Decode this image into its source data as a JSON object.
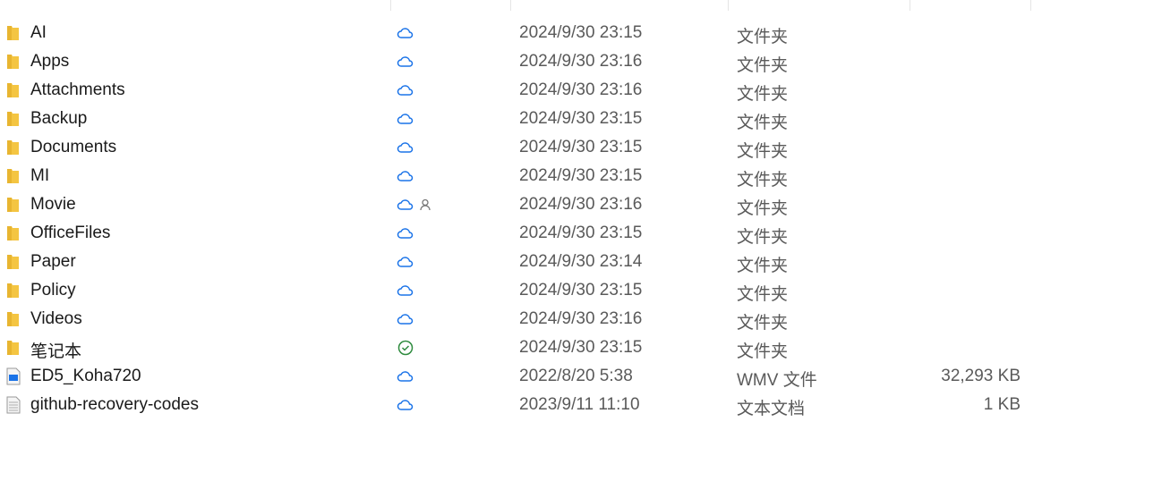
{
  "colors": {
    "cloud": "#1a73e8",
    "synced": "#2e8b3e",
    "folder": "#f4c542"
  },
  "rows": [
    {
      "name": "AI",
      "status": "cloud",
      "date": "2024/9/30 23:15",
      "type": "文件夹",
      "size": "",
      "icon": "folder"
    },
    {
      "name": "Apps",
      "status": "cloud",
      "date": "2024/9/30 23:16",
      "type": "文件夹",
      "size": "",
      "icon": "folder"
    },
    {
      "name": "Attachments",
      "status": "cloud",
      "date": "2024/9/30 23:16",
      "type": "文件夹",
      "size": "",
      "icon": "folder"
    },
    {
      "name": "Backup",
      "status": "cloud",
      "date": "2024/9/30 23:15",
      "type": "文件夹",
      "size": "",
      "icon": "folder"
    },
    {
      "name": "Documents",
      "status": "cloud",
      "date": "2024/9/30 23:15",
      "type": "文件夹",
      "size": "",
      "icon": "folder"
    },
    {
      "name": "MI",
      "status": "cloud",
      "date": "2024/9/30 23:15",
      "type": "文件夹",
      "size": "",
      "icon": "folder"
    },
    {
      "name": "Movie",
      "status": "cloud-shared",
      "date": "2024/9/30 23:16",
      "type": "文件夹",
      "size": "",
      "icon": "folder"
    },
    {
      "name": "OfficeFiles",
      "status": "cloud",
      "date": "2024/9/30 23:15",
      "type": "文件夹",
      "size": "",
      "icon": "folder"
    },
    {
      "name": "Paper",
      "status": "cloud",
      "date": "2024/9/30 23:14",
      "type": "文件夹",
      "size": "",
      "icon": "folder"
    },
    {
      "name": "Policy",
      "status": "cloud",
      "date": "2024/9/30 23:15",
      "type": "文件夹",
      "size": "",
      "icon": "folder"
    },
    {
      "name": "Videos",
      "status": "cloud",
      "date": "2024/9/30 23:16",
      "type": "文件夹",
      "size": "",
      "icon": "folder"
    },
    {
      "name": "笔记本",
      "status": "synced",
      "date": "2024/9/30 23:15",
      "type": "文件夹",
      "size": "",
      "icon": "folder"
    },
    {
      "name": "ED5_Koha720",
      "status": "cloud",
      "date": "2022/8/20 5:38",
      "type": "WMV 文件",
      "size": "32,293 KB",
      "icon": "video-file"
    },
    {
      "name": "github-recovery-codes",
      "status": "cloud",
      "date": "2023/9/11 11:10",
      "type": "文本文档",
      "size": "1 KB",
      "icon": "text-file"
    }
  ]
}
